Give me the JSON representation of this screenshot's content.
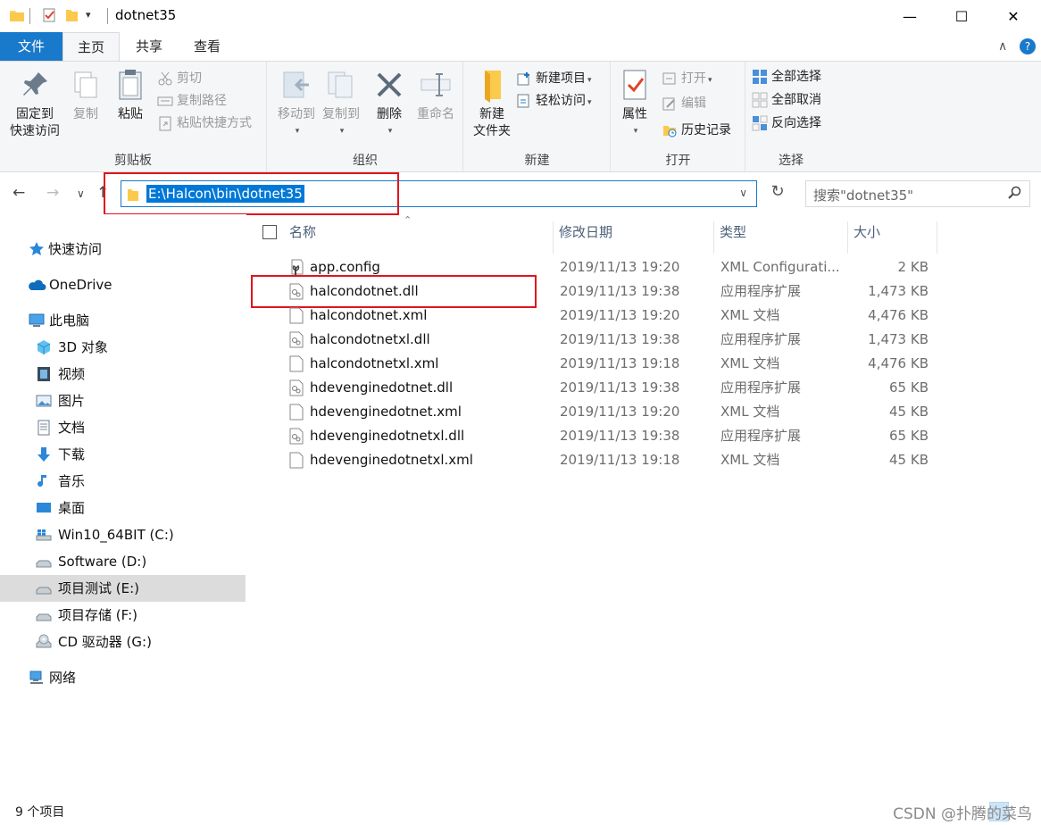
{
  "window": {
    "title": "dotnet35",
    "controls": {
      "minimize": "—",
      "maximize": "☐",
      "close": "✕"
    }
  },
  "ribbon_tabs": {
    "file": "文件",
    "home": "主页",
    "share": "共享",
    "view": "查看",
    "collapse": "∧",
    "help": "?"
  },
  "ribbon": {
    "clipboard": {
      "label": "剪贴板",
      "pin": "固定到\n快速访问",
      "pin_l1": "固定到",
      "pin_l2": "快速访问",
      "copy": "复制",
      "paste": "粘贴",
      "cut": "剪切",
      "copy_path": "复制路径",
      "paste_shortcut": "粘贴快捷方式"
    },
    "organize": {
      "label": "组织",
      "move_to": "移动到",
      "copy_to": "复制到",
      "delete": "删除",
      "rename": "重命名"
    },
    "new": {
      "label": "新建",
      "new_folder_l1": "新建",
      "new_folder_l2": "文件夹",
      "new_item": "新建项目",
      "easy_access": "轻松访问"
    },
    "open": {
      "label": "打开",
      "properties": "属性",
      "open": "打开",
      "edit": "编辑",
      "history": "历史记录"
    },
    "select": {
      "label": "选择",
      "select_all": "全部选择",
      "select_none": "全部取消",
      "invert": "反向选择"
    }
  },
  "nav": {
    "back": "←",
    "forward": "→",
    "recent": "∨",
    "up": "↑",
    "address": "E:\\Halcon\\bin\\dotnet35",
    "refresh": "↻",
    "search_placeholder": "搜索\"dotnet35\""
  },
  "sidebar": {
    "items": [
      {
        "label": "快速访问",
        "icon": "star-icon"
      },
      {
        "label": "OneDrive",
        "icon": "cloud-icon"
      },
      {
        "label": "此电脑",
        "icon": "computer-icon"
      },
      {
        "label": "3D 对象",
        "icon": "cube-icon"
      },
      {
        "label": "视频",
        "icon": "video-icon"
      },
      {
        "label": "图片",
        "icon": "picture-icon"
      },
      {
        "label": "文档",
        "icon": "document-icon"
      },
      {
        "label": "下载",
        "icon": "download-icon"
      },
      {
        "label": "音乐",
        "icon": "music-icon"
      },
      {
        "label": "桌面",
        "icon": "desktop-icon"
      },
      {
        "label": "Win10_64BIT (C:)",
        "icon": "windows-drive-icon"
      },
      {
        "label": "Software (D:)",
        "icon": "drive-icon"
      },
      {
        "label": "项目测试 (E:)",
        "icon": "drive-icon"
      },
      {
        "label": "项目存储 (F:)",
        "icon": "drive-icon"
      },
      {
        "label": "CD 驱动器 (G:)",
        "icon": "cd-drive-icon"
      },
      {
        "label": "网络",
        "icon": "network-icon"
      }
    ],
    "selected": "项目测试 (E:)"
  },
  "columns": {
    "name": "名称",
    "date": "修改日期",
    "type": "类型",
    "size": "大小"
  },
  "files": [
    {
      "name": "app.config",
      "date": "2019/11/13 19:20",
      "type": "XML Configurati...",
      "size": "2 KB",
      "icon": "config-file-icon"
    },
    {
      "name": "halcondotnet.dll",
      "date": "2019/11/13 19:38",
      "type": "应用程序扩展",
      "size": "1,473 KB",
      "icon": "dll-file-icon"
    },
    {
      "name": "halcondotnet.xml",
      "date": "2019/11/13 19:20",
      "type": "XML 文档",
      "size": "4,476 KB",
      "icon": "xml-file-icon"
    },
    {
      "name": "halcondotnetxl.dll",
      "date": "2019/11/13 19:38",
      "type": "应用程序扩展",
      "size": "1,473 KB",
      "icon": "dll-file-icon"
    },
    {
      "name": "halcondotnetxl.xml",
      "date": "2019/11/13 19:18",
      "type": "XML 文档",
      "size": "4,476 KB",
      "icon": "xml-file-icon"
    },
    {
      "name": "hdevenginedotnet.dll",
      "date": "2019/11/13 19:38",
      "type": "应用程序扩展",
      "size": "65 KB",
      "icon": "dll-file-icon"
    },
    {
      "name": "hdevenginedotnet.xml",
      "date": "2019/11/13 19:20",
      "type": "XML 文档",
      "size": "45 KB",
      "icon": "xml-file-icon"
    },
    {
      "name": "hdevenginedotnetxl.dll",
      "date": "2019/11/13 19:38",
      "type": "应用程序扩展",
      "size": "65 KB",
      "icon": "dll-file-icon"
    },
    {
      "name": "hdevenginedotnetxl.xml",
      "date": "2019/11/13 19:18",
      "type": "XML 文档",
      "size": "45 KB",
      "icon": "xml-file-icon"
    }
  ],
  "status": {
    "count": "9 个项目",
    "watermark": "CSDN @扑腾的菜鸟"
  },
  "colors": {
    "accent": "#1979ca",
    "selection": "#0078d7",
    "highlight_box": "#e0141e"
  }
}
